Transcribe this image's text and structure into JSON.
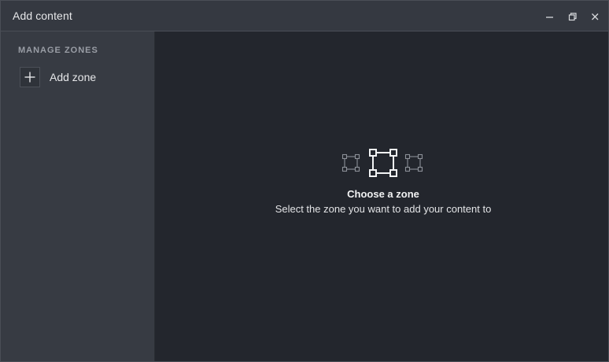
{
  "window": {
    "title": "Add content",
    "controls": {
      "minimize_icon": "minimize-icon",
      "maximize_icon": "restore-icon",
      "close_icon": "close-icon"
    }
  },
  "sidebar": {
    "heading": "MANAGE ZONES",
    "items": [
      {
        "label": "Add zone",
        "icon": "plus-icon"
      }
    ]
  },
  "main": {
    "empty_state": {
      "icon": "zone-selection-icon",
      "title": "Choose a zone",
      "subtitle": "Select the zone you want to add your content to"
    }
  },
  "colors": {
    "titlebar": "#353941",
    "sidebar": "#373b43",
    "main_background": "#23262d",
    "text_primary": "#e6e7e9",
    "text_muted": "#9a9ea6"
  }
}
